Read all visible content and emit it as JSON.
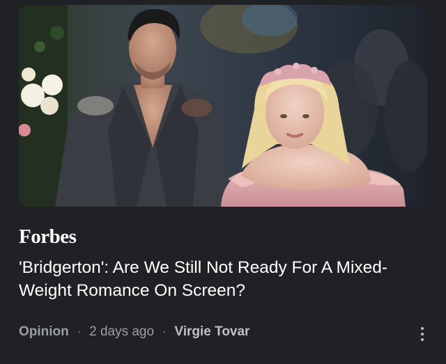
{
  "article": {
    "publisher": "Forbes",
    "headline": "'Bridgerton': Are We Still Not Ready For A Mixed-Weight Romance On Screen?",
    "section": "Opinion",
    "age": "2 days ago",
    "author": "Virgie Tovar",
    "separator": "·",
    "more_icon": "more-vert-icon"
  },
  "colors": {
    "background": "#202124",
    "text_primary": "#ffffff",
    "text_secondary": "#9aa0a6"
  }
}
